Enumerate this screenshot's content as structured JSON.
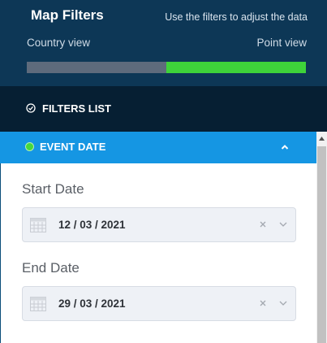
{
  "header": {
    "title": "Map Filters",
    "subtitle": "Use the filters to adjust the data",
    "view_left": "Country view",
    "view_right": "Point view"
  },
  "filters_list": {
    "label": "FILTERS LIST",
    "icon": "check-circle-icon"
  },
  "event_date": {
    "label": "EVENT DATE",
    "status_color": "#46d83c",
    "expanded": true
  },
  "start_date": {
    "label": "Start Date",
    "value": "12 / 03 / 2021"
  },
  "end_date": {
    "label": "End Date",
    "value": "29 / 03 / 2021"
  },
  "colors": {
    "header_bg": "#0d3756",
    "filters_bg": "#061f33",
    "accent_blue": "#1596e3",
    "toggle_active": "#3ed33a",
    "toggle_inactive": "#5e6b7c"
  }
}
